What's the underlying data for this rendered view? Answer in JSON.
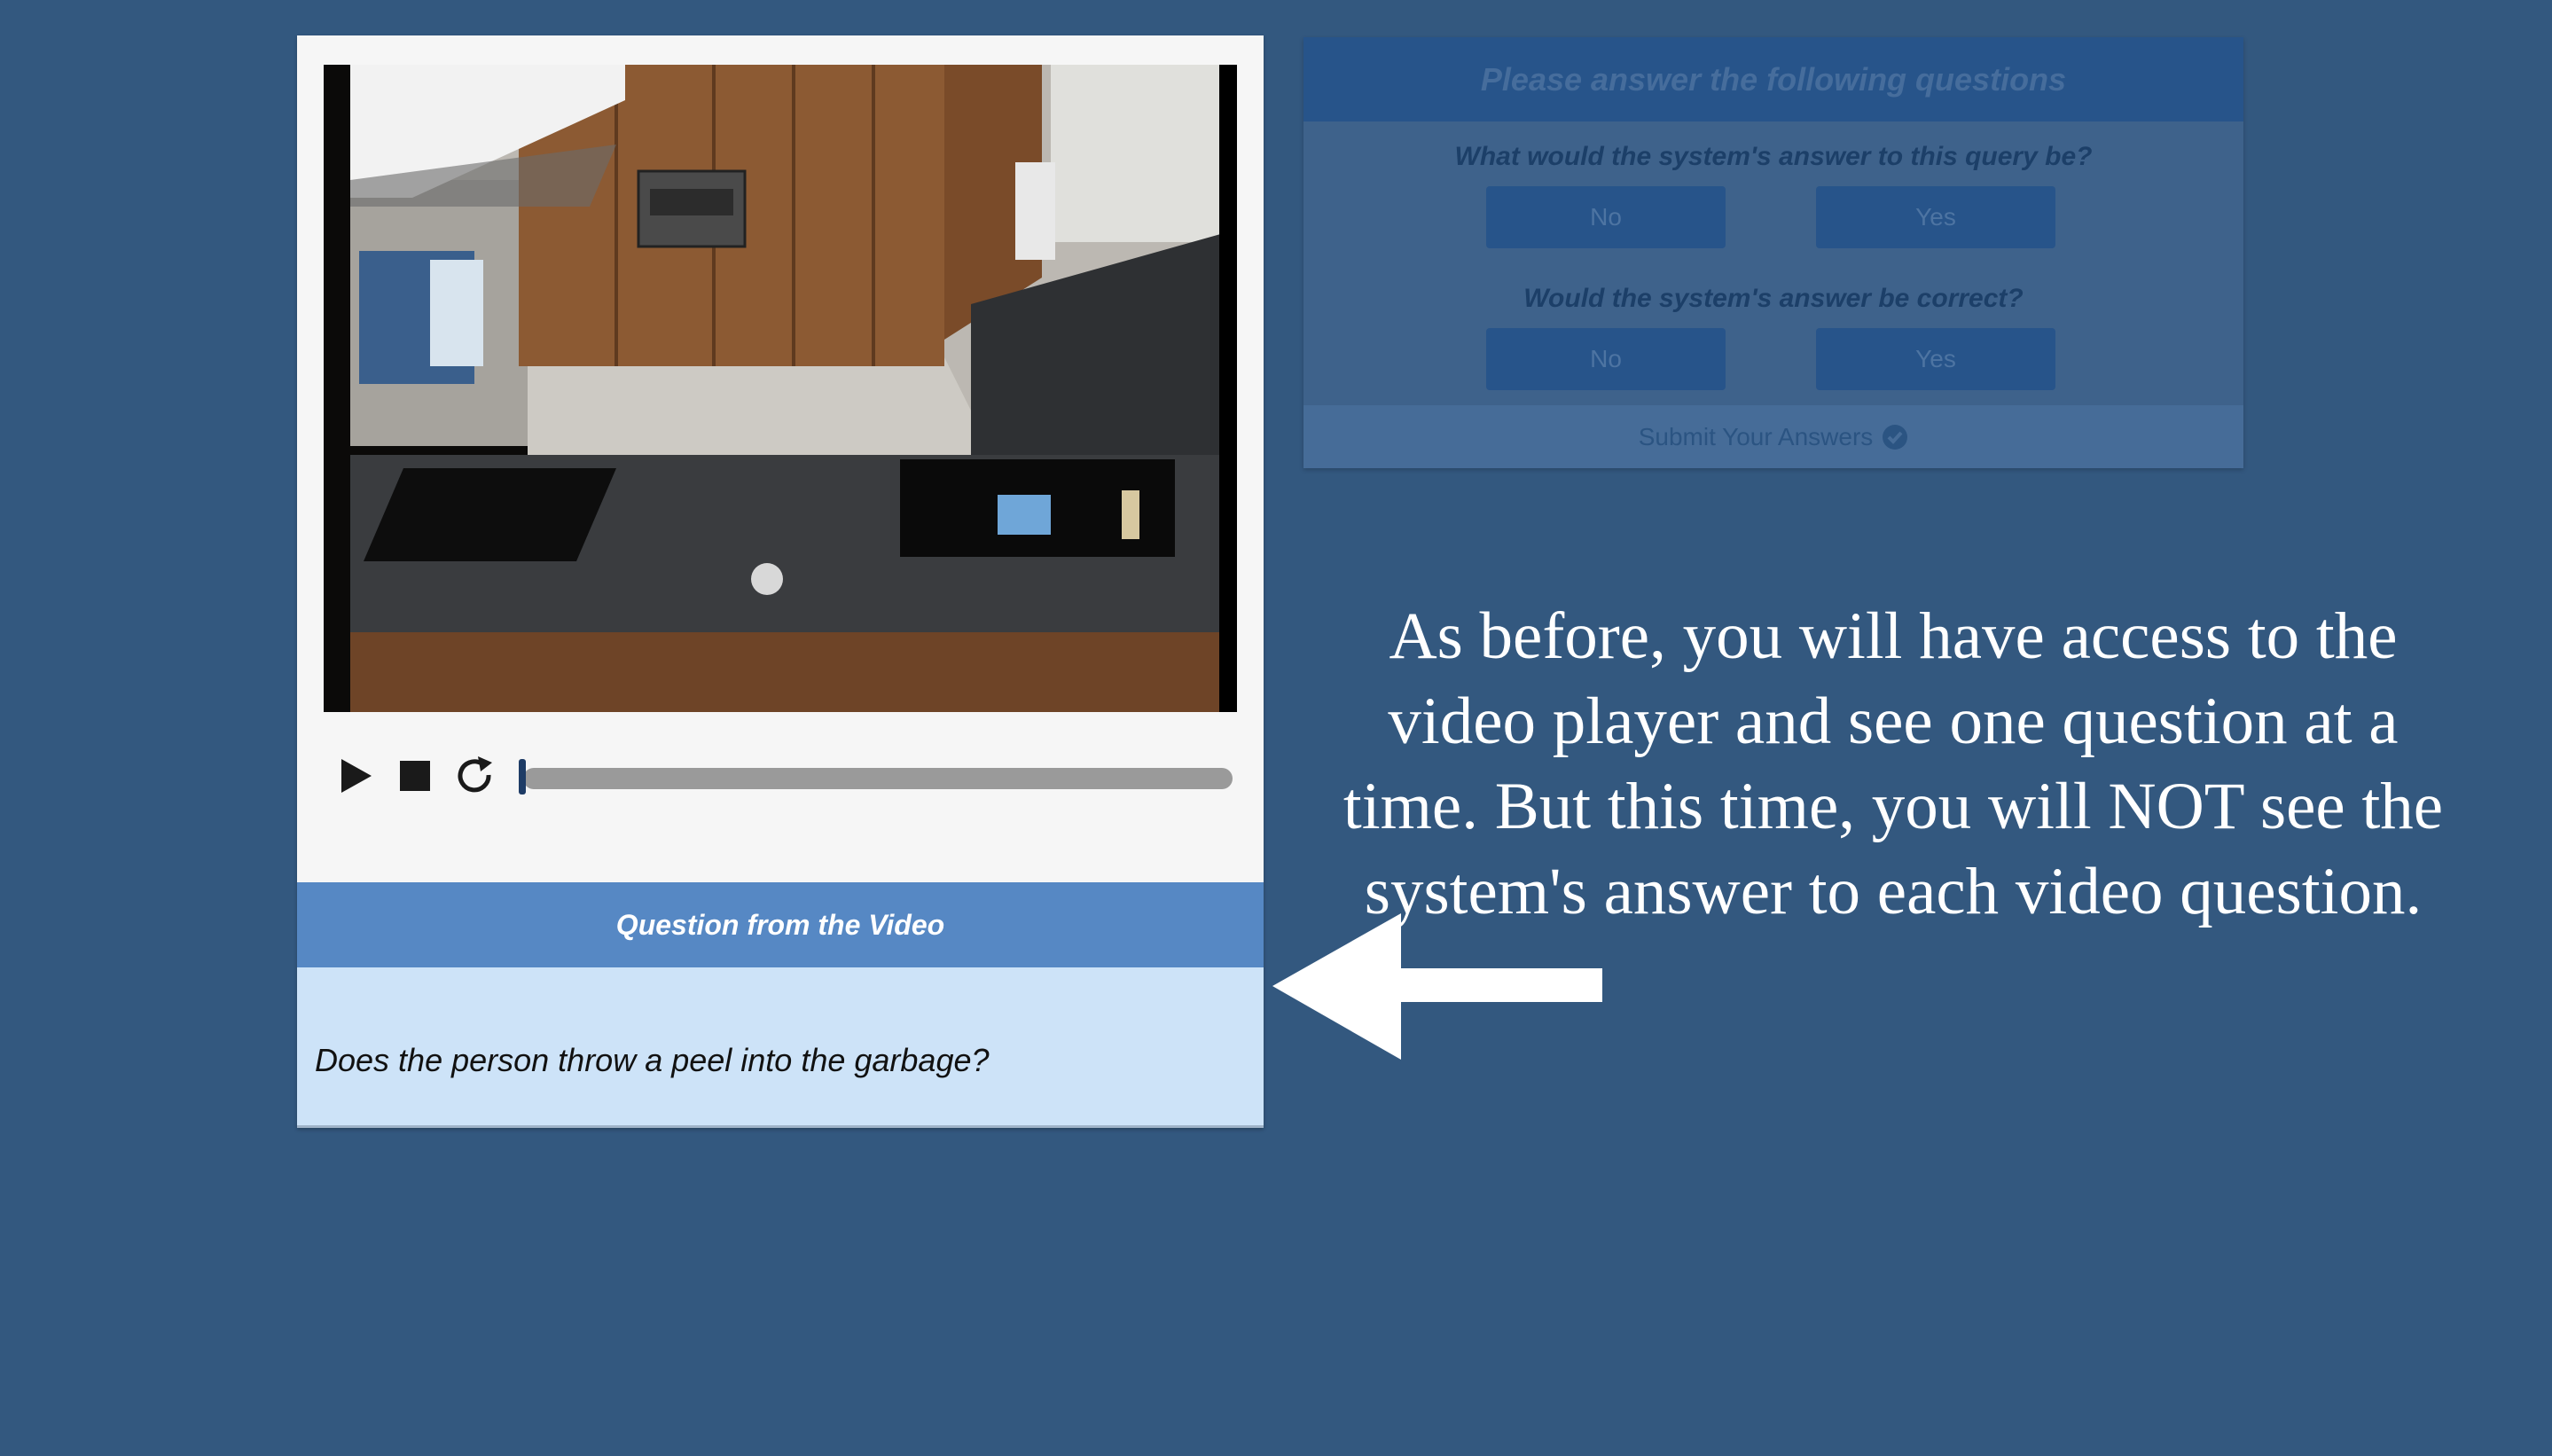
{
  "video_player": {
    "icons": {
      "play": "play-icon",
      "stop": "stop-icon",
      "replay": "replay-icon"
    },
    "progress": 0
  },
  "question_panel": {
    "header": "Question from the Video",
    "question": "Does the person throw a peel into the garbage?"
  },
  "answer_panel": {
    "header": "Please answer the following questions",
    "questions": [
      {
        "prompt": "What would the system's answer to this query be?",
        "no_label": "No",
        "yes_label": "Yes"
      },
      {
        "prompt": "Would the system's answer be correct?",
        "no_label": "No",
        "yes_label": "Yes"
      }
    ],
    "submit_label": "Submit Your Answers",
    "submit_icon": "check-circle-icon"
  },
  "instruction_text": "As before, you will have access to the video player and see one question at a time. But this time, you will NOT see the system's answer to each video question.",
  "arrow_icon": "arrow-left-icon",
  "colors": {
    "background": "#33587f",
    "question_header": "#5688c4",
    "question_body": "#cde3f8",
    "answer_button": "#27548a"
  }
}
